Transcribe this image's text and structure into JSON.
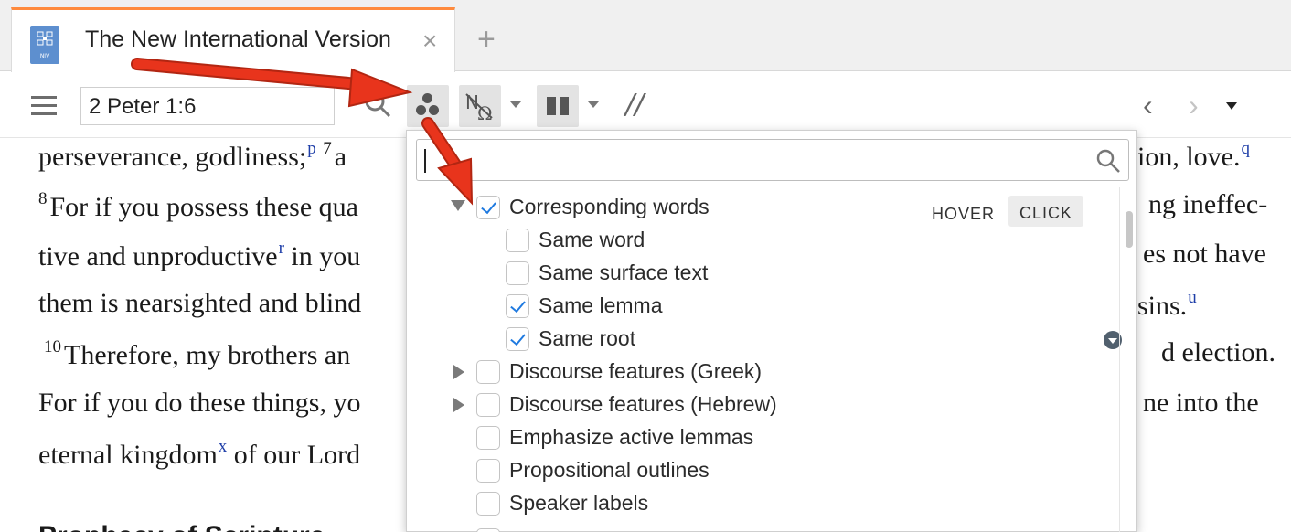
{
  "tab": {
    "title": "The New International Version",
    "icon_label": "NIV",
    "close_glyph": "×",
    "add_glyph": "+"
  },
  "toolbar": {
    "reference": "2 Peter 1:6",
    "parallel_glyph": "//",
    "back_glyph": "‹",
    "forward_glyph": "›"
  },
  "document": {
    "line1": {
      "text": "perseverance, godliness;",
      "fn": "p",
      "verse": "7",
      "tail": "a"
    },
    "line1_right": {
      "text": "ion, love.",
      "fn": "q"
    },
    "line2": {
      "verse": "8",
      "text": "For if you possess these qua"
    },
    "line2_right": {
      "text": "ng ineffec-"
    },
    "line3": {
      "text": "tive and unproductive",
      "fn": "r",
      "tail": " in you"
    },
    "line3_right": {
      "text": "es not have"
    },
    "line4": {
      "text": "them is nearsighted and blind"
    },
    "line4_right": {
      "text": "sins.",
      "fn": "u"
    },
    "line5": {
      "verse": "10",
      "text": "Therefore, my brothers an"
    },
    "line5_right": {
      "text": "d election."
    },
    "line6": {
      "text": "For if you do these things, yo"
    },
    "line6_right": {
      "text": "ne into the"
    },
    "line7": {
      "text": "eternal kingdom",
      "fn": "x",
      "tail": " of our Lord"
    },
    "heading": "Prophecy of Scripture"
  },
  "panel": {
    "filter_placeholder": "",
    "hover_label": "HOVER",
    "click_label": "CLICK",
    "options": [
      {
        "label": "Corresponding words",
        "checked": true,
        "expander": "expanded"
      },
      {
        "label": "Same word",
        "checked": false
      },
      {
        "label": "Same surface text",
        "checked": false
      },
      {
        "label": "Same lemma",
        "checked": true
      },
      {
        "label": "Same root",
        "checked": true
      },
      {
        "label": "Discourse features (Greek)",
        "checked": false,
        "expander": "collapsed"
      },
      {
        "label": "Discourse features (Hebrew)",
        "checked": false,
        "expander": "collapsed"
      },
      {
        "label": "Emphasize active lemmas",
        "checked": false
      },
      {
        "label": "Propositional outlines",
        "checked": false
      },
      {
        "label": "Speaker labels",
        "checked": false
      }
    ]
  },
  "colors": {
    "tab_accent": "#ff8a3d",
    "annotation_arrow": "#e8341c",
    "checkbox_check": "#1f7ae0",
    "footnote": "#1e3ea8"
  }
}
